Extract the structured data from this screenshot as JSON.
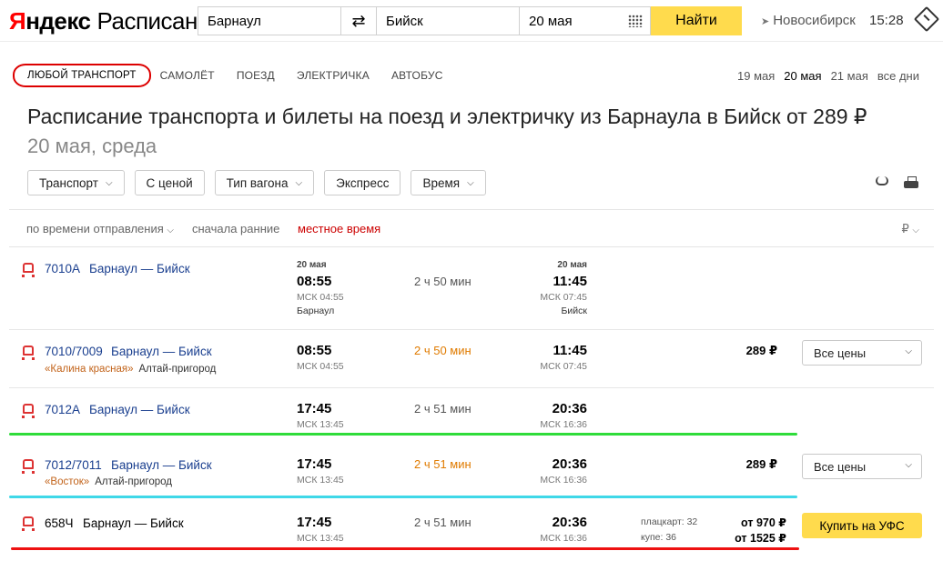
{
  "header": {
    "logo_ya": "Я",
    "logo_ndex": "ндекс",
    "logo_service": "Расписания",
    "from_value": "Барнаул",
    "swap_glyph": "⇄",
    "to_value": "Бийск",
    "date_value": "20 мая",
    "find_label": "Найти",
    "region_label": "Новосибирск",
    "time_label": "15:28"
  },
  "tabs": [
    "Любой транспорт",
    "Самолёт",
    "Поезд",
    "Электричка",
    "Автобус"
  ],
  "days": [
    "19 мая",
    "20 мая",
    "21 мая",
    "все дни"
  ],
  "title": "Расписание транспорта и билеты на поезд и электричку из Барнаула в Бийск от 289 ₽",
  "subtitle": "20 мая, среда",
  "filters": [
    "Транспорт",
    "С ценой",
    "Тип вагона",
    "Экспресс",
    "Время"
  ],
  "sort": {
    "by": "по времени отправления",
    "order": "сначала ранние",
    "local": "местное время",
    "currency": "₽"
  },
  "rows": [
    {
      "number": "7010А",
      "route": "Барнаул — Бийск",
      "dep_date": "20 мая",
      "dep_time": "08:55",
      "dep_msk": "МСК 04:55",
      "dep_station": "Барнаул",
      "duration": "2 ч 50 мин",
      "arr_date": "20 мая",
      "arr_time": "11:45",
      "arr_msk": "МСК 07:45",
      "arr_station": "Бийск"
    },
    {
      "number": "7010/7009",
      "route": "Барнаул — Бийск",
      "train_name": "«Калина красная»",
      "carrier": "Алтай-пригород",
      "dep_time": "08:55",
      "dep_msk": "МСК 04:55",
      "duration": "2 ч 50 мин",
      "arr_time": "11:45",
      "arr_msk": "МСК 07:45",
      "price": "289 ₽",
      "button": "Все цены"
    },
    {
      "number": "7012А",
      "route": "Барнаул — Бийск",
      "dep_time": "17:45",
      "dep_msk": "МСК 13:45",
      "duration": "2 ч 51 мин",
      "arr_time": "20:36",
      "arr_msk": "МСК 16:36"
    },
    {
      "number": "7012/7011",
      "route": "Барнаул — Бийск",
      "train_name": "«Восток»",
      "carrier": "Алтай-пригород",
      "dep_time": "17:45",
      "dep_msk": "МСК 13:45",
      "duration": "2 ч 51 мин",
      "arr_time": "20:36",
      "arr_msk": "МСК 16:36",
      "price": "289 ₽",
      "button": "Все цены"
    },
    {
      "number": "658Ч",
      "route": "Барнаул — Бийск",
      "dep_time": "17:45",
      "dep_msk": "МСК 13:45",
      "duration": "2 ч 51 мин",
      "arr_time": "20:36",
      "arr_msk": "МСК 16:36",
      "seat1": "плацкарт: 32",
      "seat2": "купе: 36",
      "price1": "от 970 ₽",
      "price2": "от 1525 ₽",
      "button": "Купить на УФС"
    }
  ],
  "colors": {
    "accent_yellow": "#ffdb4d",
    "link_blue": "#1a3f8f",
    "train_red": "#dd3333",
    "duration_orange": "#e07b00",
    "marker_green": "#2fdc3a",
    "marker_cyan": "#3fd8e8",
    "marker_red": "#ee1111"
  }
}
